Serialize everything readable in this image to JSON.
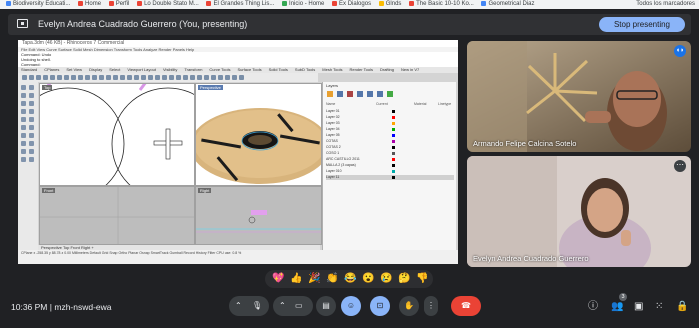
{
  "bookmarks": [
    "Biodiversity Educati...",
    "Home",
    "Perfil",
    "Lo Double Stato M...",
    "El Grandes Thing Lis...",
    "Inicio - Home",
    "Ex Dialogos",
    "Glnds",
    "The Basic 10-10 Ko...",
    "Geometrical Diaz"
  ],
  "bookmarks_right": "Todos los marcadores",
  "present_banner": {
    "text": "Evelyn Andrea Cuadrado Guerrero (You, presenting)",
    "stop_label": "Stop presenting"
  },
  "rhino": {
    "title": "Tapa.3dm (46 KB) - Rhinoceros 7 Commercial",
    "menu": "File  Edit  View  Curve  Surface  Solid  Mesh  Dimension  Transform  Tools  Analyze  Render  Panels  Help",
    "cmd_lines": [
      "Command: Undo",
      "Undoing to shell.",
      "Command:"
    ],
    "tabs": [
      "Standard",
      "CPlanes",
      "Set View",
      "Display",
      "Select",
      "Viewport Layout",
      "Visibility",
      "Transform",
      "Curve Tools",
      "Surface Tools",
      "Solid Tools",
      "SubD Tools",
      "Mesh Tools",
      "Render Tools",
      "Drafting",
      "New in V7"
    ],
    "viewports": {
      "top": "Top",
      "perspective": "Perspective",
      "front": "Front",
      "right": "Right"
    },
    "bottom_tabs": "Perspective   Top   Front   Right   +",
    "status": "CPlane  x -258.35  y 88.78  z 0.00    Millimeters    Default    Grid Snap  Ortho  Planar  Osnap  SmartTrack  Gumball  Record History  Filter  CPU use: 0.8 %",
    "layers": {
      "header": "Layers",
      "columns": [
        "Name",
        "Current",
        "Material",
        "Linetype"
      ],
      "rows": [
        {
          "name": "Layer 01",
          "color": "#000000"
        },
        {
          "name": "Layer 02",
          "color": "#ff0000"
        },
        {
          "name": "Layer 03",
          "color": "#ffa500"
        },
        {
          "name": "Layer 04",
          "color": "#00aa00"
        },
        {
          "name": "Layer 05",
          "color": "#0000ff"
        },
        {
          "name": "COTAS",
          "color": "#aa00aa"
        },
        {
          "name": "COTAS 2",
          "color": "#000000"
        },
        {
          "name": "COSO 1",
          "color": "#555555"
        },
        {
          "name": "ARC CASTILLO 2011",
          "color": "#ff0000"
        },
        {
          "name": "MALLA 2 (3 capas)",
          "color": "#000000"
        },
        {
          "name": "Layer 010",
          "color": "#00aaaa"
        },
        {
          "name": "Layer 11",
          "color": "#000000"
        }
      ]
    }
  },
  "participants": [
    {
      "name": "Armando Felipe Calcina Sotelo"
    },
    {
      "name": "Evelyn Andrea Cuadrado Guerrero"
    }
  ],
  "reactions": [
    "💖",
    "👍",
    "🎉",
    "👏",
    "😂",
    "😮",
    "😢",
    "🤔",
    "👎"
  ],
  "meeting": {
    "time": "10:36 PM",
    "separator": "|",
    "code": "mzh-nswd-ewa"
  },
  "participant_count": "3",
  "colors": {
    "accent": "#8ab4f8",
    "end_call": "#ea4335",
    "bg": "#202124"
  }
}
